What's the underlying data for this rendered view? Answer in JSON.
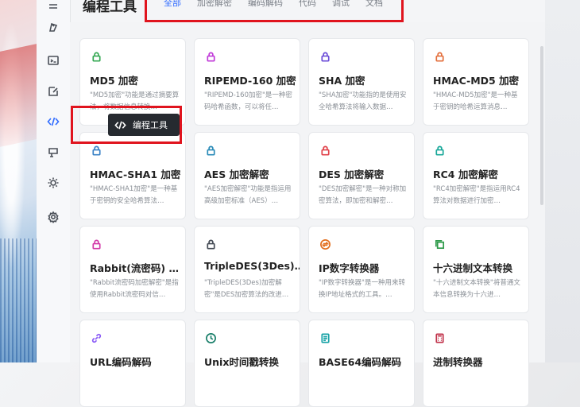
{
  "page_title": "编程工具",
  "tabs": [
    "全部",
    "加密解密",
    "编码解码",
    "代码",
    "调试",
    "文档"
  ],
  "tooltip": "编程工具",
  "colors": {
    "accent": "#2f6bff",
    "highlight": "#e0141e"
  },
  "cards": [
    {
      "title": "MD5 加密",
      "desc": "\"MD5加密\"功能是通过摘要算法，将数据信息转换…",
      "icon": "lock-icon",
      "color": "#35a853"
    },
    {
      "title": "RIPEMD-160 加密",
      "desc": "\"RIPEMD-160加密\"是一种密码哈希函数，可以将任…",
      "icon": "lock-icon",
      "color": "#c03ad8"
    },
    {
      "title": "SHA 加密",
      "desc": "\"SHA加密\"功能指的是使用安全哈希算法将输入数据…",
      "icon": "lock-icon",
      "color": "#6b4cd8"
    },
    {
      "title": "HMAC-MD5 加密",
      "desc": "\"HMAC-MD5加密\"是一种基于密钥的哈希运算消息…",
      "icon": "lock-icon",
      "color": "#e36f3c"
    },
    {
      "title": "HMAC-SHA1 加密",
      "desc": "\"HMAC-SHA1加密\"是一种基于密钥的安全哈希算法…",
      "icon": "lock-icon",
      "color": "#3b82c6"
    },
    {
      "title": "AES 加密解密",
      "desc": "\"AES加密解密\"功能是指运用高级加密标准（AES）…",
      "icon": "lock-icon",
      "color": "#2a8bb8"
    },
    {
      "title": "DES 加密解密",
      "desc": "\"DES加密解密\"是一种对称加密算法，即加密和解密…",
      "icon": "lock-icon",
      "color": "#e0424a"
    },
    {
      "title": "RC4 加密解密",
      "desc": "\"RC4加密解密\"是指运用RC4算法对数据进行加密…",
      "icon": "lock-icon",
      "color": "#1aa89a"
    },
    {
      "title": "Rabbit(流密码) …",
      "desc": "\"Rabbit流密码加密解密\"是指使用Rabbit流密码对信…",
      "icon": "lock-icon",
      "color": "#d23aa8"
    },
    {
      "title": "TripleDES(3Des)…",
      "desc": "\"TripleDES(3Des)加密解密\"是DES加密算法的改进…",
      "icon": "lock-icon",
      "color": "#444b55"
    },
    {
      "title": "IP数字转换器",
      "desc": "\"IP数字转换器\"是一种用来转换IP地址格式的工具。…",
      "icon": "swap-icon",
      "color": "#e36f1f"
    },
    {
      "title": "十六进制文本转换",
      "desc": "\"十六进制文本转换\"将普通文本信息转换为十六进…",
      "icon": "copy-icon",
      "color": "#2e9a4a"
    },
    {
      "title": "URL编码解码",
      "desc": "",
      "icon": "link-icon",
      "color": "#8b5cf6"
    },
    {
      "title": "Unix时间戳转换",
      "desc": "",
      "icon": "clock-icon",
      "color": "#1a7f6a"
    },
    {
      "title": "BASE64编码解码",
      "desc": "",
      "icon": "doc-icon",
      "color": "#17a2a6"
    },
    {
      "title": "进制转换器",
      "desc": "",
      "icon": "calc-icon",
      "color": "#c0324a"
    }
  ]
}
